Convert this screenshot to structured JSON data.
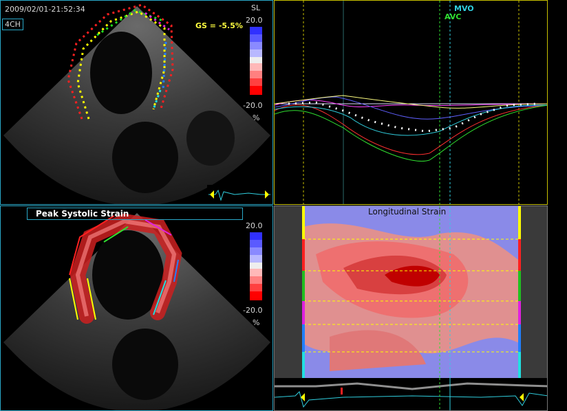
{
  "top_left": {
    "timestamp": "2009/02/01-21:52:34",
    "view_label": "4CH",
    "mode_label": "SL",
    "gs_text": "GS = -5.5%",
    "scale_max": "20.0",
    "scale_min": "-20.0",
    "scale_unit": "%"
  },
  "top_right": {
    "mvo_label": "MVO",
    "avc_label": "AVC"
  },
  "bottom_left": {
    "title": "Peak Systolic Strain",
    "scale_max": "20.0",
    "scale_min": "-20.0",
    "scale_unit": "%"
  },
  "bottom_right": {
    "title": "Longitudinal Strain"
  },
  "colors": {
    "accent_cyan": "#2aa9c9",
    "gs_yellow": "#ffff40",
    "mvo_cyan": "#30d0e0",
    "avc_green": "#30e030"
  },
  "segment_colors": [
    "#ffff00",
    "#ff2020",
    "#20c020",
    "#e020e0",
    "#2080ff",
    "#20e0e0"
  ]
}
